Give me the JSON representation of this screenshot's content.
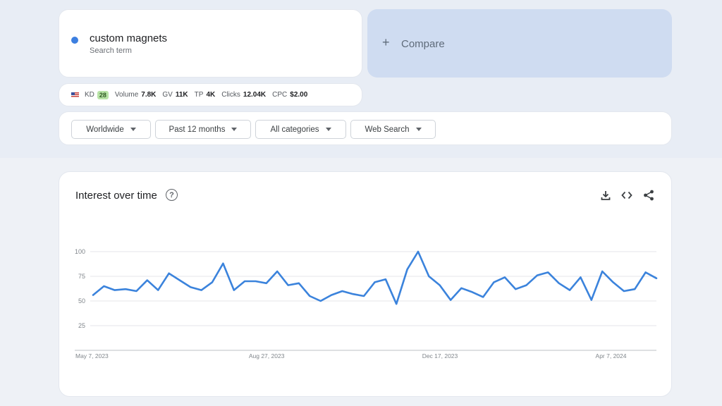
{
  "search": {
    "term": "custom magnets",
    "term_sublabel": "Search term",
    "term_color": "#3c7fe0",
    "compare_label": "Compare",
    "compare_icon": "plus-icon"
  },
  "metrics": {
    "country_icon": "us-flag-icon",
    "kd_label": "KD",
    "kd_value": "28",
    "volume_label": "Volume",
    "volume_value": "7.8K",
    "gv_label": "GV",
    "gv_value": "11K",
    "tp_label": "TP",
    "tp_value": "4K",
    "clicks_label": "Clicks",
    "clicks_value": "12.04K",
    "cpc_label": "CPC",
    "cpc_value": "$2.00"
  },
  "filters": {
    "region": "Worldwide",
    "time_range": "Past 12 months",
    "category": "All categories",
    "search_type": "Web Search"
  },
  "chart_panel": {
    "title": "Interest over time",
    "help_icon": "help-circle-icon",
    "actions": [
      "download-icon",
      "embed-code-icon",
      "share-icon"
    ]
  },
  "chart_data": {
    "type": "line",
    "title": "Interest over time",
    "xlabel": "",
    "ylabel": "",
    "ylim": [
      0,
      100
    ],
    "y_ticks": [
      25,
      50,
      75,
      100
    ],
    "x_tick_labels": [
      "May 7, 2023",
      "Aug 27, 2023",
      "Dec 17, 2023",
      "Apr 7, 2024"
    ],
    "x_tick_indices": [
      0,
      16,
      32,
      48
    ],
    "grid": true,
    "line_color": "#3b83dc",
    "series": [
      {
        "values": [
          56,
          65,
          61,
          62,
          60,
          71,
          61,
          78,
          71,
          64,
          61,
          69,
          88,
          61,
          70,
          70,
          68,
          80,
          66,
          68,
          55,
          50,
          56,
          60,
          57,
          55,
          69,
          72,
          47,
          82,
          100,
          75,
          66,
          51,
          63,
          59,
          54,
          69,
          74,
          62,
          66,
          76,
          79,
          68,
          61,
          74,
          51,
          80,
          69,
          60,
          62,
          79,
          73
        ]
      }
    ]
  }
}
